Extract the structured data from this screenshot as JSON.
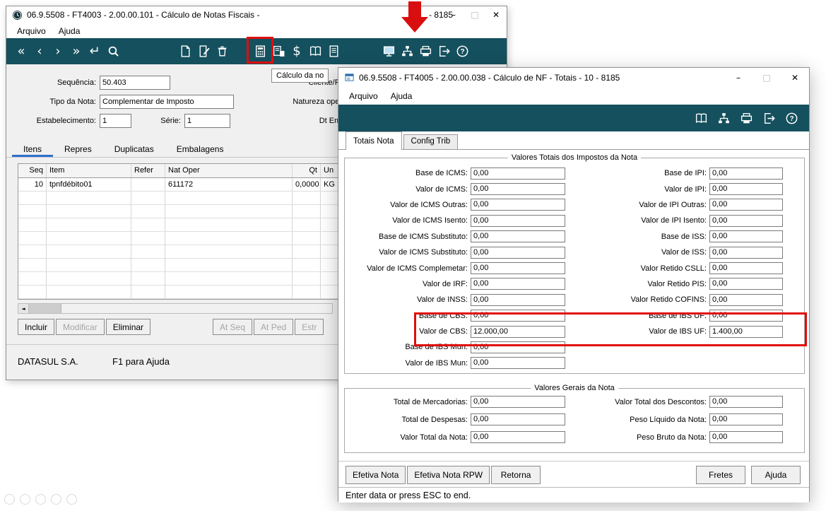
{
  "colors": {
    "toolbar_teal": "#15505e",
    "highlight_red": "#e10d0d",
    "tab_accent_blue": "#2f6fd0"
  },
  "window_controls": {
    "minimize": "–",
    "maximize": "□",
    "close": "✕"
  },
  "w1": {
    "title_left": "06.9.5508 - FT4003 - 2.00.00.101 - Cálculo de Notas Fiscais -",
    "title_right": "- 8185",
    "menu": [
      {
        "label": "Arquivo"
      },
      {
        "label": "Ajuda"
      }
    ],
    "toolbar_groups": [
      [
        {
          "name": "first-icon",
          "glyph": "«"
        },
        {
          "name": "prev-icon",
          "glyph": "‹"
        },
        {
          "name": "next-icon",
          "glyph": "›"
        },
        {
          "name": "last-icon",
          "glyph": "»"
        },
        {
          "name": "return-icon",
          "glyph": "↵"
        },
        {
          "name": "search-icon"
        }
      ],
      [
        {
          "name": "new-document-icon"
        },
        {
          "name": "edit-document-icon"
        },
        {
          "name": "delete-icon"
        }
      ],
      [
        {
          "name": "calculator-icon",
          "highlight": true
        },
        {
          "name": "calc-sheet-icon"
        },
        {
          "name": "dollar-icon",
          "glyph": "$"
        },
        {
          "name": "book-icon"
        },
        {
          "name": "document-info-icon"
        }
      ],
      [
        {
          "name": "monitor-icon"
        },
        {
          "name": "org-tree-icon"
        },
        {
          "name": "printer-icon"
        },
        {
          "name": "exit-icon"
        },
        {
          "name": "help-icon"
        }
      ]
    ],
    "tooltip": "Cálculo da no",
    "form": {
      "sequencia": {
        "label": "Sequência:",
        "value": "50.403"
      },
      "tipo_nota": {
        "label": "Tipo da Nota:",
        "value": "Complementar de Imposto"
      },
      "estabelecimento": {
        "label": "Estabelecimento:",
        "value": "1"
      },
      "serie": {
        "label": "Série:",
        "value": "1"
      },
      "cliente": {
        "label": "Cliente/Fornec:"
      },
      "natureza": {
        "label": "Natureza operação:"
      },
      "dt_emissao": {
        "label": "Dt Emissão:"
      }
    },
    "tabs": [
      {
        "label": "Itens",
        "selected": true
      },
      {
        "label": "Repres"
      },
      {
        "label": "Duplicatas"
      },
      {
        "label": "Embalagens"
      }
    ],
    "table": {
      "headers": [
        "Seq",
        "Item",
        "Refer",
        "Nat Oper",
        "Qt",
        "Un"
      ],
      "rows": [
        [
          "10",
          "tpnfdébito01",
          "",
          "611172",
          "0,0000",
          "KG"
        ]
      ],
      "empty_row_count": 8
    },
    "scrollbar": {
      "left_arrow": "◄"
    },
    "action_buttons": [
      {
        "label": "Incluir",
        "enabled": true
      },
      {
        "label": "Modificar",
        "enabled": false
      },
      {
        "label": "Eliminar",
        "enabled": true
      }
    ],
    "right_buttons": [
      {
        "label": "At Seq",
        "enabled": false
      },
      {
        "label": "At Ped",
        "enabled": false
      },
      {
        "label": "Estr",
        "enabled": false
      }
    ],
    "status": {
      "company": "DATASUL S.A.",
      "help": "F1 para Ajuda"
    }
  },
  "w2": {
    "title": "06.9.5508 - FT4005 - 2.00.00.038 - Cálculo de NF - Totais - 10 - 8185",
    "menu": [
      {
        "label": "Arquivo"
      },
      {
        "label": "Ajuda"
      }
    ],
    "toolbar_groups": [
      [
        {
          "name": "book-icon"
        },
        {
          "name": "org-tree-icon"
        },
        {
          "name": "printer-icon"
        },
        {
          "name": "exit-icon"
        },
        {
          "name": "help-icon"
        }
      ]
    ],
    "tabs": [
      {
        "label": "Totais Nota",
        "selected": true
      },
      {
        "label": "Config Trib"
      }
    ],
    "groups": {
      "impostos": {
        "title": "Valores Totais dos Impostos da Nota",
        "left": [
          {
            "label": "Base de ICMS:",
            "value": "0,00"
          },
          {
            "label": "Valor de ICMS:",
            "value": "0,00"
          },
          {
            "label": "Valor de ICMS Outras:",
            "value": "0,00"
          },
          {
            "label": "Valor de ICMS Isento:",
            "value": "0,00"
          },
          {
            "label": "Base de ICMS Substituto:",
            "value": "0,00"
          },
          {
            "label": "Valor de ICMS Substituto:",
            "value": "0,00"
          },
          {
            "label": "Valor de ICMS Complemetar:",
            "value": "0,00"
          },
          {
            "label": "Valor de IRF:",
            "value": "0,00"
          },
          {
            "label": "Valor de INSS:",
            "value": "0,00"
          },
          {
            "label": "Base de CBS:",
            "value": "0,00"
          },
          {
            "label": "Valor de CBS:",
            "value": "12.000,00"
          },
          {
            "label": "Base de IBS Mun:",
            "value": "0,00"
          },
          {
            "label": "Valor de IBS Mun:",
            "value": "0,00"
          }
        ],
        "right": [
          {
            "label": "Base de IPI:",
            "value": "0,00"
          },
          {
            "label": "Valor de IPI:",
            "value": "0,00"
          },
          {
            "label": "Valor de IPI Outras:",
            "value": "0,00"
          },
          {
            "label": "Valor de IPI Isento:",
            "value": "0,00"
          },
          {
            "label": "Base de ISS:",
            "value": "0,00"
          },
          {
            "label": "Valor de ISS:",
            "value": "0,00"
          },
          {
            "label": "Valor Retido CSLL:",
            "value": "0,00"
          },
          {
            "label": "Valor Retido PIS:",
            "value": "0,00"
          },
          {
            "label": "Valor Retido COFINS:",
            "value": "0,00"
          },
          {
            "label": "Base de IBS UF:",
            "value": "0,00"
          },
          {
            "label": "Valor de IBS UF:",
            "value": "1.400,00"
          }
        ]
      },
      "gerais": {
        "title": "Valores Gerais da Nota",
        "left": [
          {
            "label": "Total de Mercadorias:",
            "value": "0,00"
          },
          {
            "label": "Total de Despesas:",
            "value": "0,00"
          },
          {
            "label": "Valor Total da Nota:",
            "value": "0,00"
          }
        ],
        "right": [
          {
            "label": "Valor Total dos Descontos:",
            "value": "0,00"
          },
          {
            "label": "Peso Líquido da Nota:",
            "value": "0,00"
          },
          {
            "label": "Peso Bruto da Nota:",
            "value": "0,00"
          }
        ]
      }
    },
    "footer_buttons_left": [
      {
        "label": "Efetiva Nota"
      },
      {
        "label": "Efetiva Nota RPW"
      },
      {
        "label": "Retorna"
      }
    ],
    "footer_buttons_right": [
      {
        "label": "Fretes"
      },
      {
        "label": "Ajuda"
      }
    ],
    "status": "Enter data or press ESC to end."
  }
}
